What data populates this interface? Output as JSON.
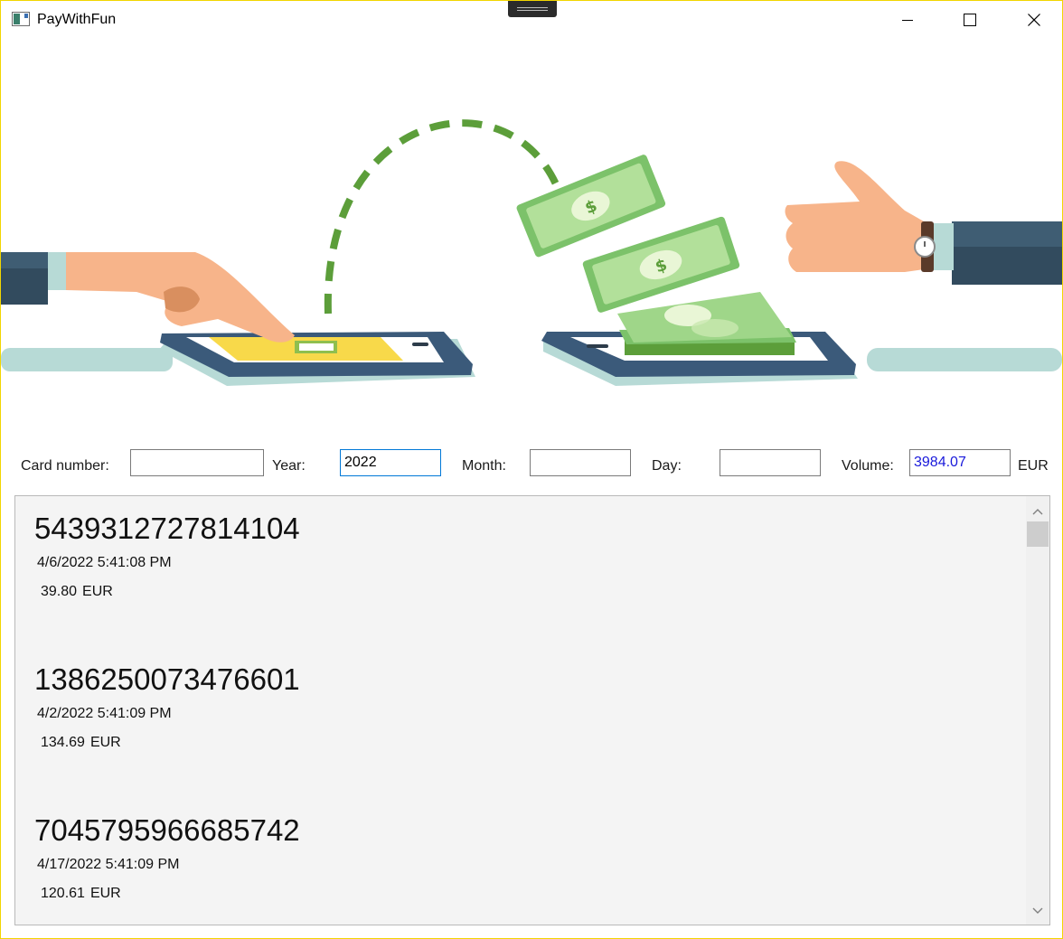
{
  "window": {
    "title": "PayWithFun"
  },
  "filters": {
    "card_number": {
      "label": "Card number:",
      "value": ""
    },
    "year": {
      "label": "Year:",
      "value": "2022"
    },
    "month": {
      "label": "Month:",
      "value": ""
    },
    "day": {
      "label": "Day:",
      "value": ""
    },
    "volume": {
      "label": "Volume:",
      "value": "3984.07",
      "currency": "EUR"
    }
  },
  "transactions": [
    {
      "card": "5439312727814104",
      "date": "4/6/2022 5:41:08 PM",
      "amount": "39.80",
      "currency": "EUR"
    },
    {
      "card": "1386250073476601",
      "date": "4/2/2022 5:41:09 PM",
      "amount": "134.69",
      "currency": "EUR"
    },
    {
      "card": "7045795966685742",
      "date": "4/17/2022 5:41:09 PM",
      "amount": "120.61",
      "currency": "EUR"
    }
  ],
  "colors": {
    "money_green": "#7cc26a",
    "dash_green": "#5c9e3a",
    "tablet_blue": "#3b5a7a",
    "shadow_teal": "#b7dad6",
    "skin": "#f7b48a",
    "sleeve": "#324b5e",
    "window_border": "#f2d600"
  }
}
